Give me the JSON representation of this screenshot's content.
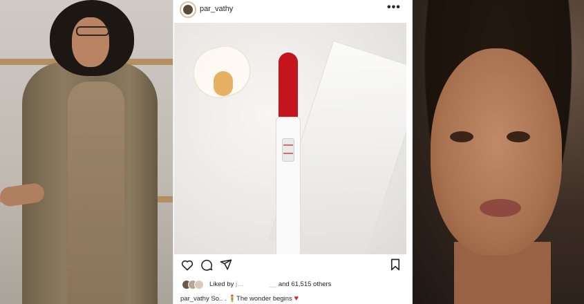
{
  "post": {
    "username": "par_vathy",
    "more_label": "•••",
    "likes": {
      "liked_by_label": "Liked by",
      "liked_by_name": "j…",
      "and_label": "and",
      "count": "61,515",
      "others_label": "others"
    },
    "caption": {
      "username": "par_vathy",
      "text": "So.. . 🧍The wonder begins",
      "heart": "♥"
    }
  },
  "icons": {
    "like": "heart-icon",
    "comment": "comment-icon",
    "share": "send-icon",
    "save": "bookmark-icon",
    "more": "more-icon"
  },
  "colors": {
    "test_cap": "#c4141e",
    "heart": "#e0262e",
    "text": "#262626"
  }
}
